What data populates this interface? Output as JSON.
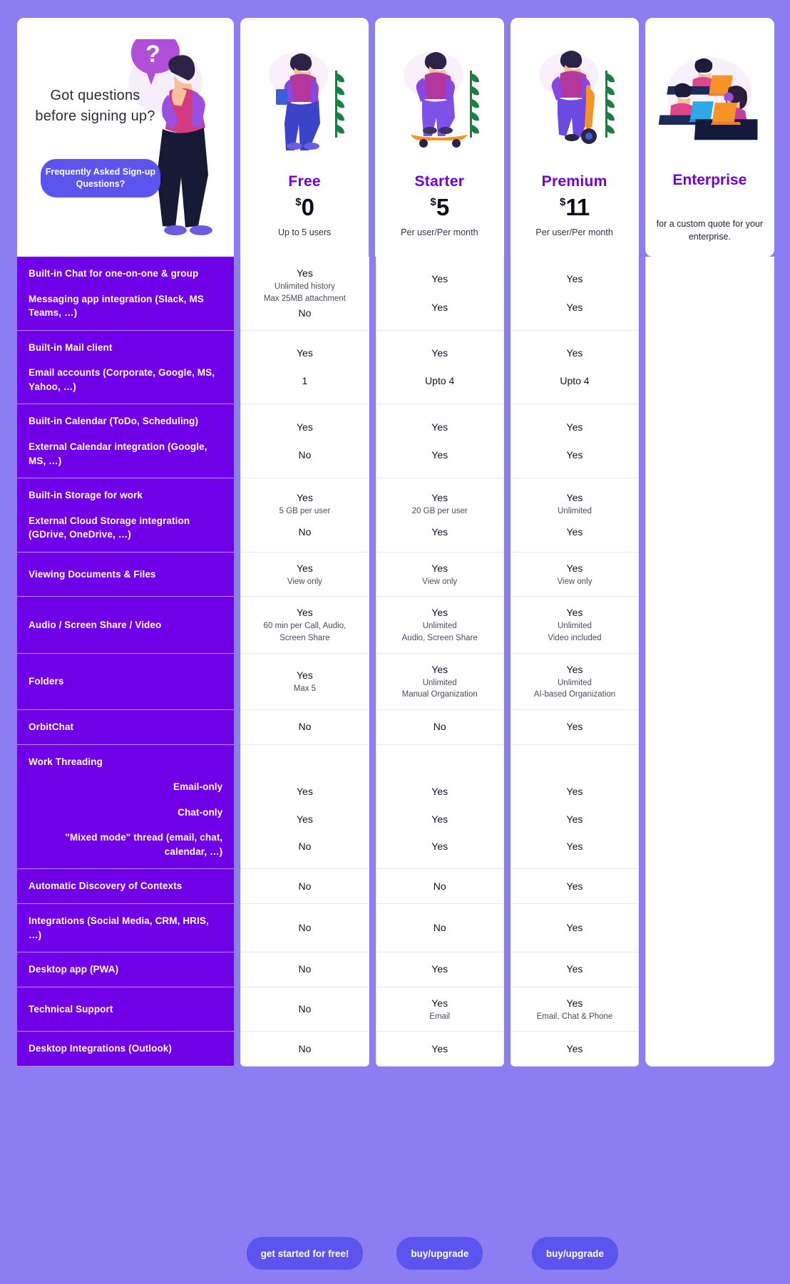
{
  "faq": {
    "headline": "Got questions before signing up?",
    "button_label": "Frequently Asked Sign-up Questions?",
    "illustration": "person-thinking-question-mark"
  },
  "plans": [
    {
      "name": "Free",
      "currency": "$",
      "price": "0",
      "sub": "Up to 5 users",
      "illustration": "person-standing-holding-book",
      "cta": "get started for free!"
    },
    {
      "name": "Starter",
      "currency": "$",
      "price": "5",
      "sub": "Per user/Per month",
      "illustration": "person-on-skateboard",
      "cta": "buy/upgrade"
    },
    {
      "name": "Premium",
      "currency": "$",
      "price": "11",
      "sub": "Per user/Per month",
      "illustration": "person-on-scooter",
      "cta": "buy/upgrade"
    }
  ],
  "enterprise": {
    "name": "Enterprise",
    "sub": "for a custom quote for your enterprise.",
    "illustration": "team-at-desks-with-laptops"
  },
  "colors": {
    "page_background": "#8d7df2",
    "feature_column": "#7000e8",
    "plan_name": "#7000e0",
    "cta_button": "#5b54ee",
    "card_background": "#ffffff"
  },
  "rows": [
    {
      "features": [
        "Built-in Chat for one-on-one & group",
        "Messaging app integration (Slack, MS Teams, …)"
      ],
      "cells": [
        [
          {
            "v": "Yes",
            "n": [
              "Unlimited history",
              "Max 25MB attachment"
            ]
          },
          {
            "v": "No",
            "n": []
          }
        ],
        [
          {
            "v": "Yes",
            "n": []
          },
          {
            "v": "Yes",
            "n": []
          }
        ],
        [
          {
            "v": "Yes",
            "n": []
          },
          {
            "v": "Yes",
            "n": []
          }
        ]
      ]
    },
    {
      "features": [
        "Built-in Mail client",
        "Email accounts (Corporate, Google, MS, Yahoo, …)"
      ],
      "cells": [
        [
          {
            "v": "Yes",
            "n": []
          },
          {
            "v": "1",
            "n": []
          }
        ],
        [
          {
            "v": "Yes",
            "n": []
          },
          {
            "v": "Upto 4",
            "n": []
          }
        ],
        [
          {
            "v": "Yes",
            "n": []
          },
          {
            "v": "Upto 4",
            "n": []
          }
        ]
      ]
    },
    {
      "features": [
        "Built-in Calendar (ToDo, Scheduling)",
        "External Calendar integration (Google, MS, …)"
      ],
      "cells": [
        [
          {
            "v": "Yes",
            "n": []
          },
          {
            "v": "No",
            "n": []
          }
        ],
        [
          {
            "v": "Yes",
            "n": []
          },
          {
            "v": "Yes",
            "n": []
          }
        ],
        [
          {
            "v": "Yes",
            "n": []
          },
          {
            "v": "Yes",
            "n": []
          }
        ]
      ]
    },
    {
      "features": [
        "Built-in Storage for work",
        "External Cloud Storage integration (GDrive, OneDrive, …)"
      ],
      "cells": [
        [
          {
            "v": "Yes",
            "n": [
              "5 GB per user"
            ]
          },
          {
            "v": "No",
            "n": []
          }
        ],
        [
          {
            "v": "Yes",
            "n": [
              "20 GB per user"
            ]
          },
          {
            "v": "Yes",
            "n": []
          }
        ],
        [
          {
            "v": "Yes",
            "n": [
              "Unlimited"
            ]
          },
          {
            "v": "Yes",
            "n": []
          }
        ]
      ]
    },
    {
      "features": [
        "Viewing Documents & Files"
      ],
      "cells": [
        [
          {
            "v": "Yes",
            "n": [
              "View only"
            ]
          }
        ],
        [
          {
            "v": "Yes",
            "n": [
              "View only"
            ]
          }
        ],
        [
          {
            "v": "Yes",
            "n": [
              "View only"
            ]
          }
        ]
      ]
    },
    {
      "features": [
        "Audio / Screen Share / Video"
      ],
      "cells": [
        [
          {
            "v": "Yes",
            "n": [
              "60 min per Call, Audio,",
              "Screen Share"
            ]
          }
        ],
        [
          {
            "v": "Yes",
            "n": [
              "Unlimited",
              "Audio, Screen Share"
            ]
          }
        ],
        [
          {
            "v": "Yes",
            "n": [
              "Unlimited",
              "Video included"
            ]
          }
        ]
      ]
    },
    {
      "features": [
        "Folders"
      ],
      "cells": [
        [
          {
            "v": "Yes",
            "n": [
              "Max 5"
            ]
          }
        ],
        [
          {
            "v": "Yes",
            "n": [
              "Unlimited",
              "Manual Organization"
            ]
          }
        ],
        [
          {
            "v": "Yes",
            "n": [
              "Unlimited",
              "AI-based Organization"
            ]
          }
        ]
      ]
    },
    {
      "features": [
        "OrbitChat"
      ],
      "cells": [
        [
          {
            "v": "No",
            "n": []
          }
        ],
        [
          {
            "v": "No",
            "n": []
          }
        ],
        [
          {
            "v": "Yes",
            "n": []
          }
        ]
      ]
    },
    {
      "features": [
        "Work Threading",
        "Email-only",
        "Chat-only",
        "\"Mixed mode\" thread (email, chat, calendar, …)"
      ],
      "indent_from": 1,
      "cells": [
        [
          {
            "empty": true
          },
          {
            "v": "Yes",
            "n": []
          },
          {
            "v": "Yes",
            "n": []
          },
          {
            "v": "No",
            "n": []
          }
        ],
        [
          {
            "empty": true
          },
          {
            "v": "Yes",
            "n": []
          },
          {
            "v": "Yes",
            "n": []
          },
          {
            "v": "Yes",
            "n": []
          }
        ],
        [
          {
            "empty": true
          },
          {
            "v": "Yes",
            "n": []
          },
          {
            "v": "Yes",
            "n": []
          },
          {
            "v": "Yes",
            "n": []
          }
        ]
      ]
    },
    {
      "features": [
        "Automatic Discovery of Contexts"
      ],
      "cells": [
        [
          {
            "v": "No",
            "n": []
          }
        ],
        [
          {
            "v": "No",
            "n": []
          }
        ],
        [
          {
            "v": "Yes",
            "n": []
          }
        ]
      ]
    },
    {
      "features": [
        "Integrations (Social Media, CRM, HRIS, …)"
      ],
      "cells": [
        [
          {
            "v": "No",
            "n": []
          }
        ],
        [
          {
            "v": "No",
            "n": []
          }
        ],
        [
          {
            "v": "Yes",
            "n": []
          }
        ]
      ]
    },
    {
      "features": [
        "Desktop app (PWA)"
      ],
      "cells": [
        [
          {
            "v": "No",
            "n": []
          }
        ],
        [
          {
            "v": "Yes",
            "n": []
          }
        ],
        [
          {
            "v": "Yes",
            "n": []
          }
        ]
      ]
    },
    {
      "features": [
        "Technical Support"
      ],
      "cells": [
        [
          {
            "v": "No",
            "n": []
          }
        ],
        [
          {
            "v": "Yes",
            "n": [
              "Email"
            ]
          }
        ],
        [
          {
            "v": "Yes",
            "n": [
              "Email, Chat & Phone"
            ]
          }
        ]
      ]
    },
    {
      "features": [
        "Desktop Integrations (Outlook)"
      ],
      "cells": [
        [
          {
            "v": "No",
            "n": []
          }
        ],
        [
          {
            "v": "Yes",
            "n": []
          }
        ],
        [
          {
            "v": "Yes",
            "n": []
          }
        ]
      ]
    }
  ]
}
